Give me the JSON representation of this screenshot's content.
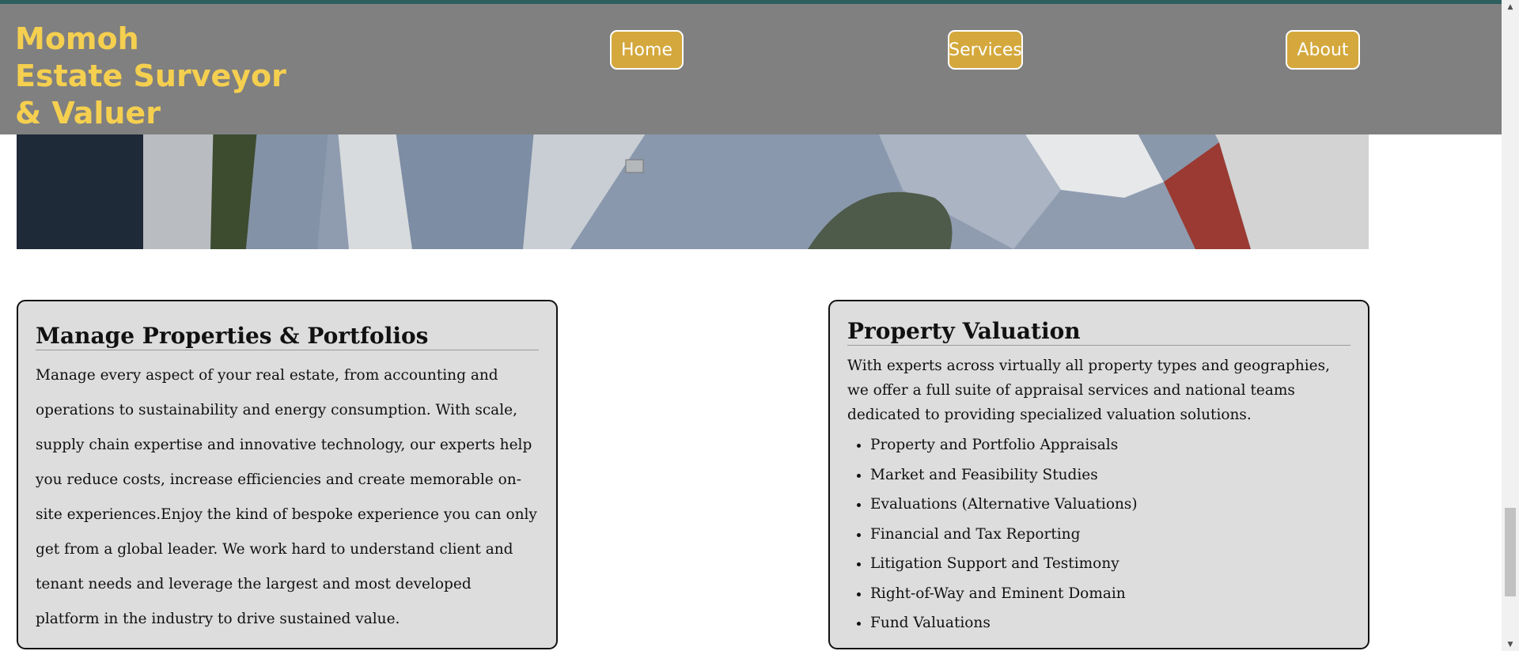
{
  "header": {
    "brand_lines": [
      "Momoh",
      "Estate Surveyor",
      "& Valuer"
    ],
    "nav": {
      "home": "Home",
      "services": "Services",
      "about": "About"
    }
  },
  "hero": {
    "image": "aerial-rooftop-photo"
  },
  "manage": {
    "title": "Manage Properties & Portfolios",
    "body": "Manage every aspect of your real estate, from accounting and operations to sustainability and energy consumption. With scale, supply chain expertise and innovative technology, our experts help you reduce costs, increase efficiencies and create memorable on-site experiences.Enjoy the kind of bespoke experience you can only get from a global leader. We work hard to understand client and tenant needs and leverage the largest and most developed platform in the industry to drive sustained value."
  },
  "valuation": {
    "title": "Property Valuation",
    "intro": "With experts across virtually all property types and geographies, we offer a full suite of appraisal services and national teams dedicated to providing specialized valuation solutions.",
    "items": [
      "Property and Portfolio Appraisals",
      "Market and Feasibility Studies",
      "Evaluations (Alternative Valuations)",
      "Financial and Tax Reporting",
      "Litigation Support and Testimony",
      "Right-of-Way and Eminent Domain",
      "Fund Valuations"
    ]
  },
  "colors": {
    "header_bg": "#808080",
    "brand_text": "#f5cf4f",
    "nav_button": "#d4a83c",
    "card_bg": "#dddddd",
    "top_line": "#2e5f5f"
  },
  "scrollbar": {
    "up_icon": "arrow-up-icon",
    "down_icon": "arrow-down-icon"
  }
}
